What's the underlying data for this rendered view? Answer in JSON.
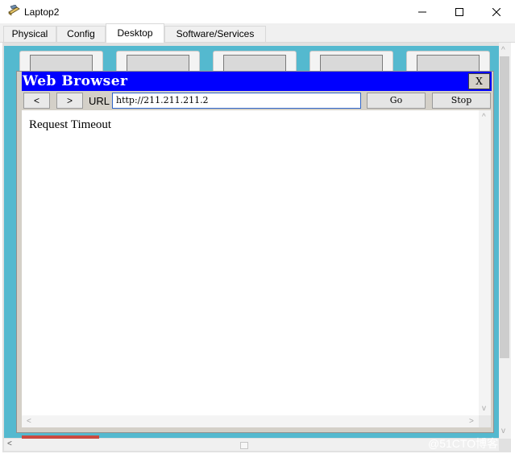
{
  "window": {
    "title": "Laptop2",
    "minimize_glyph": "─",
    "maximize_glyph": "☐",
    "close_glyph": "✕"
  },
  "tabs": [
    {
      "label": "Physical",
      "active": false
    },
    {
      "label": "Config",
      "active": false
    },
    {
      "label": "Desktop",
      "active": true
    },
    {
      "label": "Software/Services",
      "active": false
    }
  ],
  "browser": {
    "title": "Web Browser",
    "close_label": "X",
    "back_glyph": "<",
    "forward_glyph": ">",
    "url_label": "URL",
    "url_value": "http://211.211.211.2",
    "go_label": "Go",
    "stop_label": "Stop",
    "content_text": "Request Timeout"
  },
  "scroll_arrows": {
    "up": "^",
    "down": "v",
    "left": "<",
    "right": ">"
  },
  "watermark": "@51CTO博客",
  "colors": {
    "desktop_bg": "#54b9cf",
    "browser_title_bg": "#0000ff",
    "url_border": "#2e64c9"
  }
}
